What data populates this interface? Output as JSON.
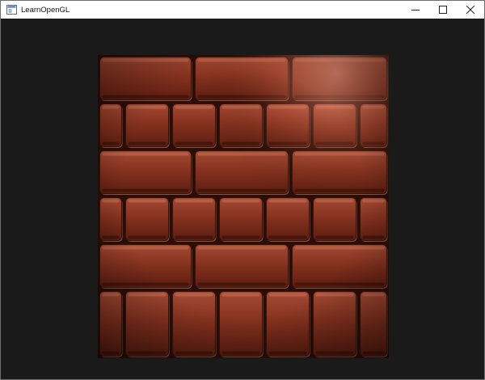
{
  "window": {
    "title": "LearnOpenGL",
    "icon": "window-icon",
    "controls": {
      "minimize_icon": "minimize-icon",
      "maximize_icon": "maximize-icon",
      "close_icon": "close-icon"
    }
  },
  "viewport": {
    "background_color": "#1a1a1a",
    "scene": "brick-wall-normal-mapped-quad"
  },
  "colors": {
    "brick_base": "#7a2a1a",
    "brick_light": "#c86a4e",
    "brick_dark": "#3a120a",
    "mortar": "#d9a98a",
    "mortar_shadow": "#2a0c06"
  }
}
